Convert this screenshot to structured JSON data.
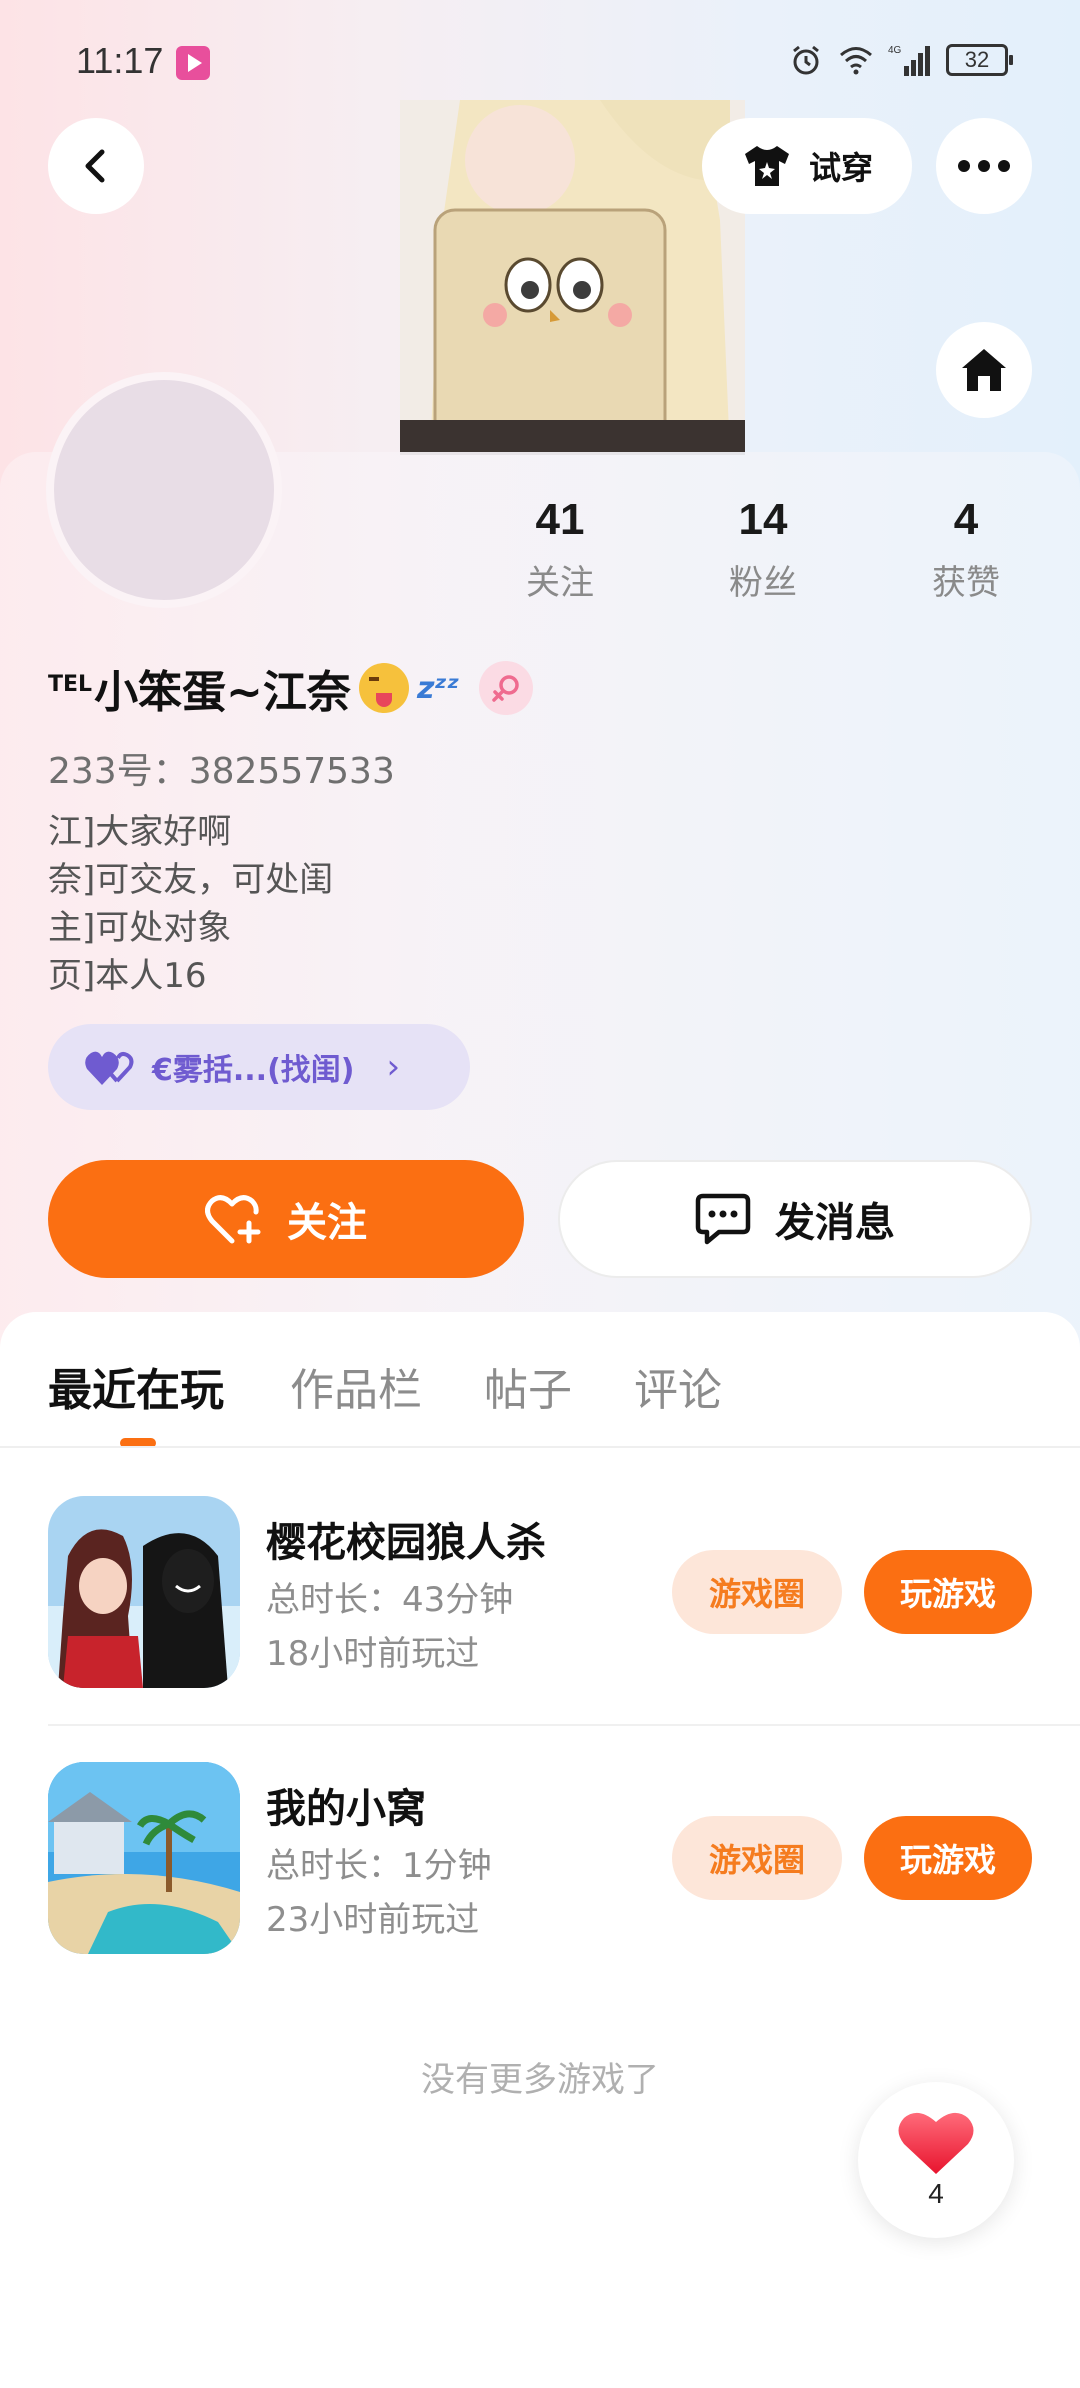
{
  "status_bar": {
    "time": "11:17",
    "network": "4G",
    "battery": "32"
  },
  "header": {
    "try_on_label": "试穿"
  },
  "profile": {
    "stats": [
      {
        "value": "41",
        "label": "关注"
      },
      {
        "value": "14",
        "label": "粉丝"
      },
      {
        "value": "4",
        "label": "获赞"
      }
    ],
    "name_prefix": "TEL",
    "name": "小笨蛋~江奈",
    "zzz": "zᶻᶻ",
    "uid": "233号：382557533",
    "bio": [
      "江]大家好啊",
      "奈]可交友，可处闺",
      "主]可处对象",
      "页]本人16"
    ],
    "group_label": "€雾括...(找闺)",
    "follow_label": "关注",
    "message_label": "发消息"
  },
  "tabs": [
    "最近在玩",
    "作品栏",
    "帖子",
    "评论"
  ],
  "games": [
    {
      "title": "樱花校园狼人杀",
      "duration": "总时长：43分钟",
      "last_played": "18小时前玩过",
      "circle_label": "游戏圈",
      "play_label": "玩游戏"
    },
    {
      "title": "我的小窝",
      "duration": "总时长：1分钟",
      "last_played": "23小时前玩过",
      "circle_label": "游戏圈",
      "play_label": "玩游戏"
    }
  ],
  "footer_text": "没有更多游戏了",
  "like_fab": {
    "count": "4"
  },
  "colors": {
    "accent": "#fb6f12",
    "group_pill_bg": "#e6e2f6",
    "group_pill_text": "#6f5bd0"
  }
}
